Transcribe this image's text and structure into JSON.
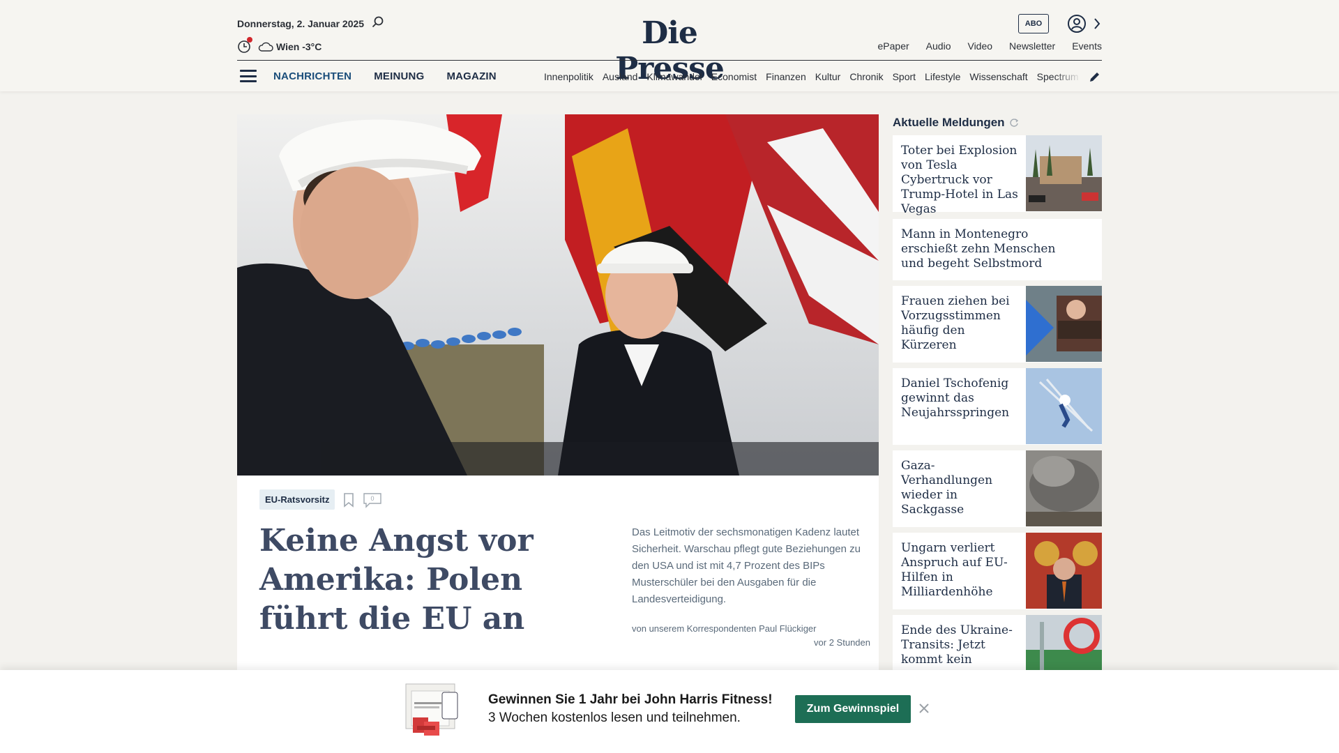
{
  "header": {
    "date": "Donnerstag, 2. Januar 2025",
    "weather": "Wien -3°C",
    "logo": "Die Presse",
    "abo_label": "ABO",
    "toplinks": [
      "ePaper",
      "Audio",
      "Video",
      "Newsletter",
      "Events"
    ],
    "mainnav": [
      "NACHRICHTEN",
      "MEINUNG",
      "MAGAZIN"
    ],
    "subnav": [
      "Innenpolitik",
      "Ausland",
      "Klimawandel",
      "Economist",
      "Finanzen",
      "Kultur",
      "Chronik",
      "Sport",
      "Lifestyle",
      "Wissenschaft",
      "Spectrum"
    ],
    "brand_color": "#1e2d45",
    "accent_color": "#1a4d7a"
  },
  "hero": {
    "tag": "EU-Ratsvorsitz",
    "comment_count": "0",
    "title": "Keine Angst vor Amerika: Polen führt die EU an",
    "lead": "Das Leitmotiv der sechsmonatigen Kadenz lautet Sicherheit. Warschau pflegt gute Beziehungen zu den USA und ist mit 4,7 Prozent des BIPs Musterschüler bei den Ausgaben für die Landesverteidigung.",
    "byline": "von unserem Korrespondenten Paul Flückiger",
    "time": "vor 2 Stunden"
  },
  "sidebar": {
    "title": "Aktuelle Meldungen",
    "items": [
      {
        "text": "Toter bei Explosion von Tesla Cybertruck vor Trump-Hotel in Las Vegas",
        "has_image": true
      },
      {
        "text": "Mann in Montenegro erschießt zehn Menschen und begeht Selbstmord",
        "has_image": false
      },
      {
        "text": "Frauen ziehen bei Vorzugsstimmen häufig den Kürzeren",
        "has_image": true
      },
      {
        "text": "Daniel Tschofenig gewinnt das Neujahrsspringen",
        "has_image": true
      },
      {
        "text": "Gaza-Verhandlungen wieder in Sackgasse",
        "has_image": true
      },
      {
        "text": "Ungarn verliert Anspruch auf EU-Hilfen in Milliardenhöhe",
        "has_image": true
      },
      {
        "text": "Ende des Ukraine-Transits: Jetzt kommt kein",
        "has_image": true
      }
    ]
  },
  "banner": {
    "line1": "Gewinnen Sie 1 Jahr bei John Harris Fitness!",
    "line2": "3 Wochen kostenlos lesen und teilnehmen.",
    "button": "Zum Gewinnspiel",
    "button_color": "#1d6e55"
  }
}
